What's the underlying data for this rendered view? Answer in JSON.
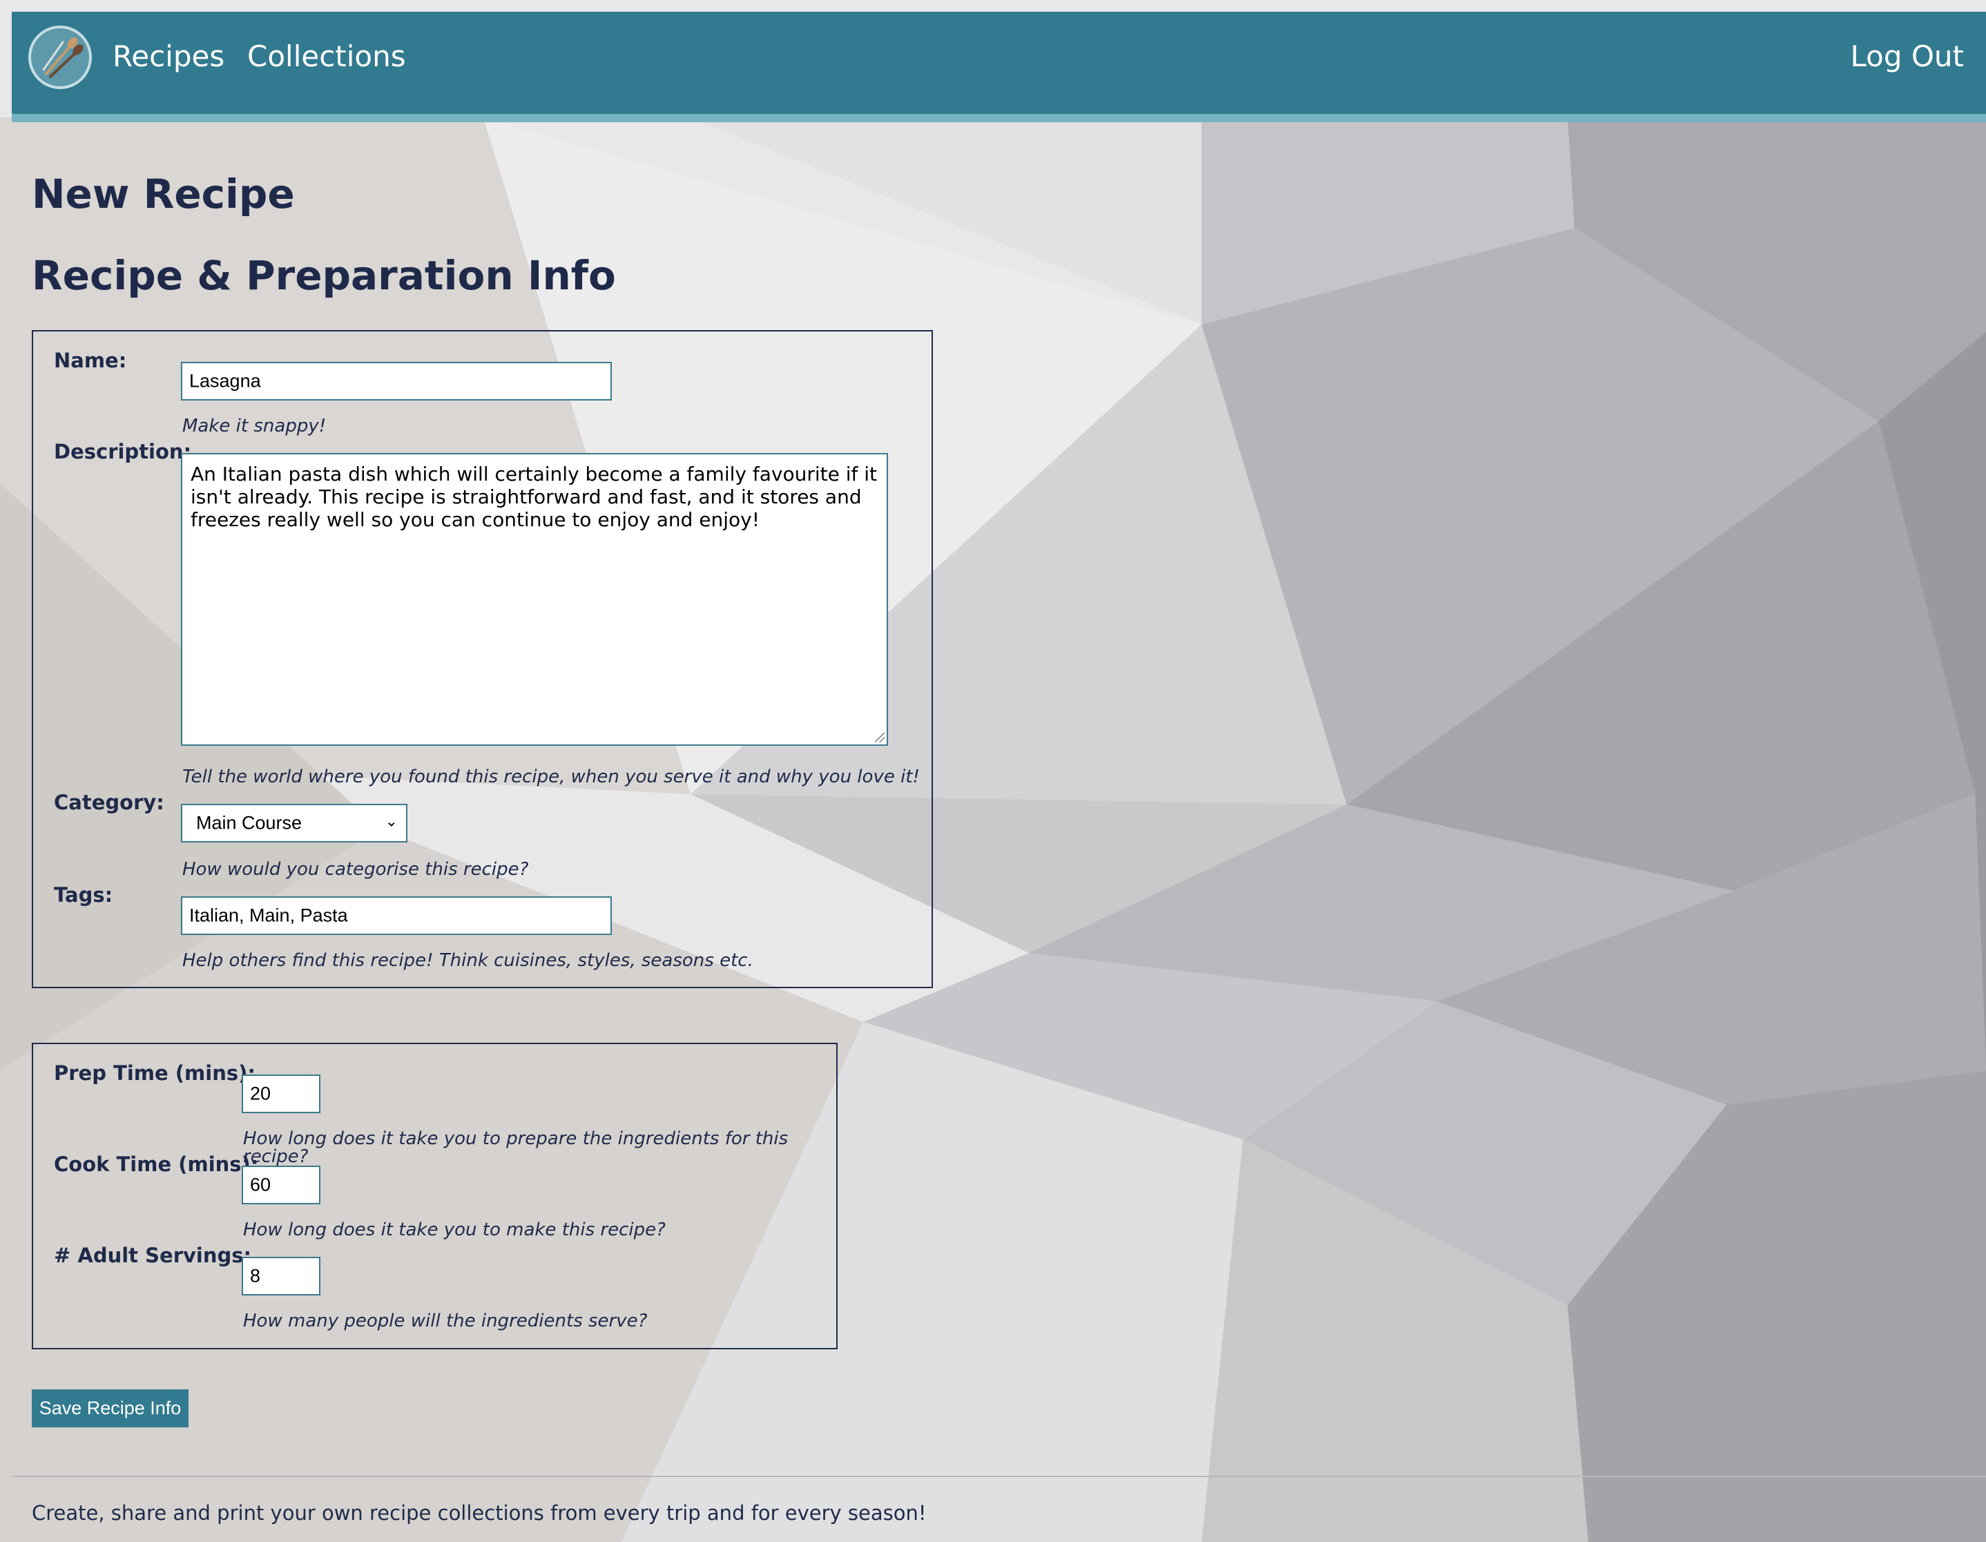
{
  "nav": {
    "recipes": "Recipes",
    "collections": "Collections",
    "logout": "Log Out",
    "logo_icon": "whisk-spoon-logo-icon"
  },
  "page": {
    "title": "New Recipe",
    "section_title": "Recipe & Preparation Info"
  },
  "recipe_info": {
    "name": {
      "label": "Name:",
      "value": "Lasagna",
      "hint": "Make it snappy!"
    },
    "description": {
      "label": "Description:",
      "value": "An Italian pasta dish which will certainly become a family favourite if it isn't already. This recipe is straightforward and fast, and it stores and freezes really well so you can continue to enjoy and enjoy!",
      "hint": "Tell the world where you found this recipe, when you serve it and why you love it!"
    },
    "category": {
      "label": "Category:",
      "value": "Main Course",
      "hint": "How would you categorise this recipe?"
    },
    "tags": {
      "label": "Tags:",
      "value": "Italian, Main, Pasta",
      "hint": "Help others find this recipe! Think cuisines, styles, seasons etc."
    }
  },
  "prep_info": {
    "prep_time": {
      "label": "Prep Time (mins):",
      "value": "20",
      "hint": "How long does it take you to prepare the ingredients for this recipe?"
    },
    "cook_time": {
      "label": "Cook Time (mins):",
      "value": "60",
      "hint": "How long does it take you to make this recipe?"
    },
    "servings": {
      "label": "# Adult Servings:",
      "value": "8",
      "hint": "How many people will the ingredients serve?"
    }
  },
  "actions": {
    "save": "Save Recipe Info"
  },
  "footer": {
    "text": "Create, share and print your own recipe collections from every trip and for every season!"
  },
  "colors": {
    "nav": "#327a8f",
    "nav_border": "#75b3c2",
    "heading": "#1f2a4a",
    "button": "#327a8f"
  }
}
